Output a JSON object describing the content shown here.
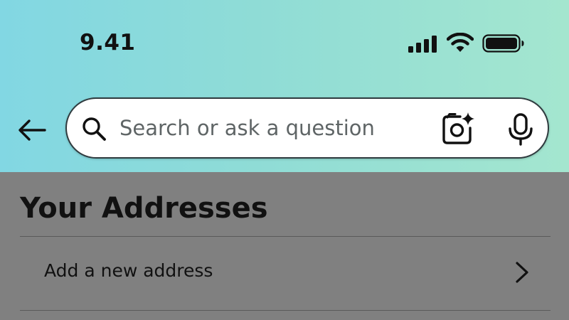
{
  "status_bar": {
    "time": "9.41",
    "icons": [
      "cellular-signal-icon",
      "wifi-icon",
      "battery-icon"
    ]
  },
  "header": {
    "back_icon": "arrow-left-icon",
    "search": {
      "placeholder": "Search or ask a question",
      "value": "",
      "camera_icon": "camera-sparkle-icon",
      "mic_icon": "microphone-icon"
    }
  },
  "main": {
    "title": "Your Addresses",
    "items": [
      {
        "label": "Add a new address",
        "icon": "chevron-right-icon"
      }
    ]
  },
  "colors": {
    "header_gradient_start": "#82d7e3",
    "header_gradient_end": "#a4e6cf",
    "overlay_background": "#808080",
    "search_border": "#2f3b3f",
    "text_primary": "#111111"
  }
}
